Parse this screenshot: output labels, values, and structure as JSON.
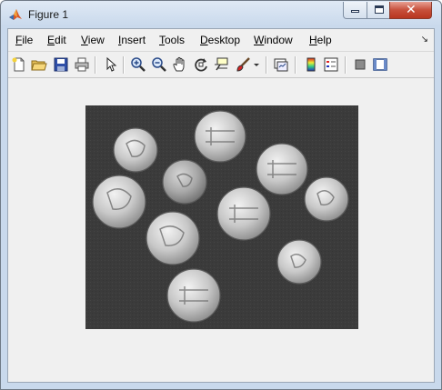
{
  "window": {
    "title": "Figure 1",
    "icon": "matlab-icon",
    "controls": [
      "minimize-icon",
      "maximize-icon",
      "close-icon"
    ]
  },
  "menu": {
    "items": [
      {
        "label": "File",
        "mnemonic": "F",
        "rest": "ile"
      },
      {
        "label": "Edit",
        "mnemonic": "E",
        "rest": "dit"
      },
      {
        "label": "View",
        "mnemonic": "V",
        "rest": "iew"
      },
      {
        "label": "Insert",
        "mnemonic": "I",
        "rest": "nsert"
      },
      {
        "label": "Tools",
        "mnemonic": "T",
        "rest": "ools"
      },
      {
        "label": "Desktop",
        "mnemonic": "D",
        "rest": "esktop"
      },
      {
        "label": "Window",
        "mnemonic": "W",
        "rest": "indow"
      },
      {
        "label": "Help",
        "mnemonic": "H",
        "rest": "elp"
      }
    ],
    "dock_glyph": "↘"
  },
  "toolbar": {
    "buttons": [
      "new-figure-icon",
      "open-file-icon",
      "save-icon",
      "print-icon",
      "edit-plot-arrow-icon",
      "zoom-in-icon",
      "zoom-out-icon",
      "pan-hand-icon",
      "rotate-3d-icon",
      "data-cursor-icon",
      "brush-icon",
      "brush-dropdown-icon",
      "link-plot-icon",
      "colorbar-icon",
      "legend-icon",
      "hide-plot-tools-icon",
      "show-plot-tools-icon"
    ]
  },
  "figure": {
    "content": "grayscale photograph of ten coins on a dark background",
    "background_color": "#3a3a3a",
    "coin_count": 10
  },
  "colors": {
    "titlebar": "#c9d9ec",
    "client_bg": "#f0f0f0",
    "close_button": "#c7503b"
  }
}
